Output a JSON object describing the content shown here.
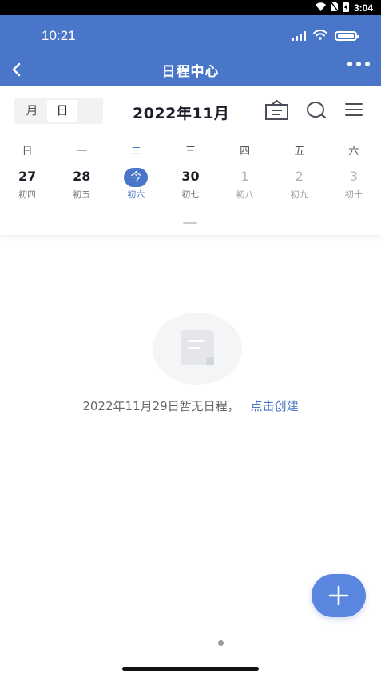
{
  "system_bar": {
    "time": "3:04"
  },
  "status_bar": {
    "time": "10:21"
  },
  "header": {
    "title": "日程中心"
  },
  "view_toggle": {
    "month_label": "月",
    "day_label": "日",
    "selected": "日"
  },
  "month_title": "2022年11月",
  "toolbar_icons": [
    "calendar-today-icon",
    "search-icon",
    "menu-icon"
  ],
  "weekdays": [
    "日",
    "一",
    "二",
    "三",
    "四",
    "五",
    "六"
  ],
  "dates": [
    {
      "num": "27",
      "lunar": "初四",
      "state": "past"
    },
    {
      "num": "28",
      "lunar": "初五",
      "state": "past"
    },
    {
      "num": "今",
      "lunar": "初六",
      "state": "today"
    },
    {
      "num": "30",
      "lunar": "初七",
      "state": "past"
    },
    {
      "num": "1",
      "lunar": "初八",
      "state": "future"
    },
    {
      "num": "2",
      "lunar": "初九",
      "state": "future"
    },
    {
      "num": "3",
      "lunar": "初十",
      "state": "future"
    }
  ],
  "empty_state": {
    "message": "2022年11月29日暂无日程，",
    "action_label": "点击创建"
  },
  "colors": {
    "primary": "#4a76c9",
    "fab": "#5b86e0"
  }
}
